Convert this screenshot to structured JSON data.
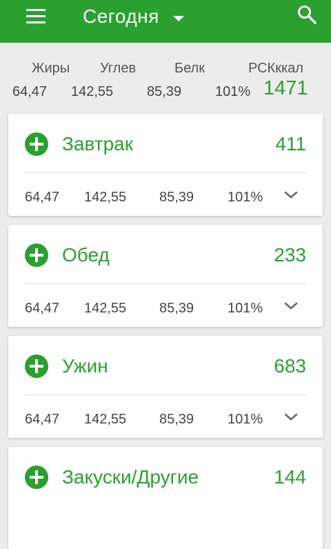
{
  "header": {
    "title": "Сегодня"
  },
  "summary": {
    "labels": [
      "Жиры",
      "Углев",
      "Белк",
      "РСКккал"
    ],
    "values": [
      "64,47",
      "142,55",
      "85,39",
      "101%"
    ],
    "kcal": "1471"
  },
  "meals": [
    {
      "name": "Завтрак",
      "total": "411",
      "macros": [
        "64,47",
        "142,55",
        "85,39",
        "101%"
      ]
    },
    {
      "name": "Обед",
      "total": "233",
      "macros": [
        "64,47",
        "142,55",
        "85,39",
        "101%"
      ]
    },
    {
      "name": "Ужин",
      "total": "683",
      "macros": [
        "64,47",
        "142,55",
        "85,39",
        "101%"
      ]
    },
    {
      "name": "Закуски/Другие",
      "total": "144"
    }
  ],
  "colors": {
    "accent": "#2aa02e",
    "background": "#ececec"
  },
  "icons": [
    "menu-icon",
    "dropdown-caret-icon",
    "search-icon",
    "add-circle-icon",
    "chevron-down-icon"
  ]
}
